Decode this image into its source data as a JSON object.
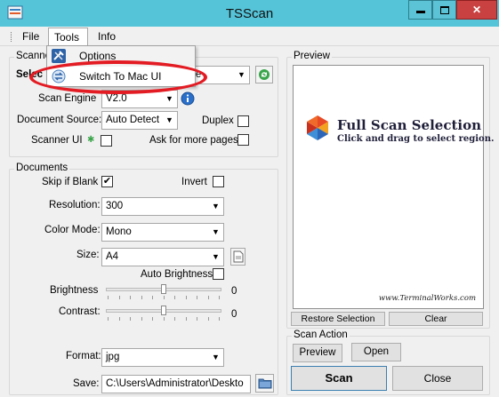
{
  "window": {
    "title": "TSScan",
    "controls": {
      "minimize": "—",
      "maximize": "□",
      "close": "✕"
    }
  },
  "menu": {
    "file": "File",
    "tools": "Tools",
    "info": "Info"
  },
  "tools_menu": {
    "options": "Options",
    "switch": "Switch To Mac UI"
  },
  "scanner": {
    "group_label": "Scanne",
    "select_label": "Selec",
    "device_value": "ftware",
    "engine_label": "Scan Engine",
    "engine_value": "V2.0",
    "source_label": "Document Source:",
    "source_value": "Auto Detect",
    "duplex_label": "Duplex",
    "duplex_checked": false,
    "scanner_ui_label": "Scanner UI",
    "scanner_ui_checked": false,
    "ask_more_label": "Ask for more pages",
    "ask_more_checked": false
  },
  "documents": {
    "group_label": "Documents",
    "skip_blank_label": "Skip if Blank",
    "skip_blank_checked": true,
    "skip_blank_mark": "✔",
    "invert_label": "Invert",
    "invert_checked": false,
    "resolution_label": "Resolution:",
    "resolution_value": "300",
    "color_mode_label": "Color Mode:",
    "color_mode_value": "Mono",
    "size_label": "Size:",
    "size_value": "A4",
    "auto_brightness_label": "Auto Brightness",
    "auto_brightness_checked": false,
    "brightness_label": "Brightness",
    "brightness_value": "0",
    "brightness_level": 0.5,
    "contrast_label": "Contrast:",
    "contrast_value": "0",
    "contrast_level": 0.5,
    "format_label": "Format:",
    "format_value": "jpg",
    "save_label": "Save:",
    "save_value": "C:\\Users\\Administrator\\Deskto"
  },
  "preview": {
    "group_label": "Preview",
    "logo_title": "Full Scan Selection",
    "logo_subtitle": "Click and drag to select region.",
    "url": "www.TerminalWorks.com",
    "restore_button": "Restore  Selection",
    "clear_button": "Clear"
  },
  "scan_action": {
    "group_label": "Scan Action",
    "preview_button": "Preview",
    "open_button": "Open",
    "scan_button": "Scan",
    "close_button": "Close"
  },
  "colors": {
    "titlebar": "#55c4d8",
    "close_button": "#c94141",
    "highlight_ellipse": "#e31b23",
    "info_icon": "#2a6fc9"
  }
}
